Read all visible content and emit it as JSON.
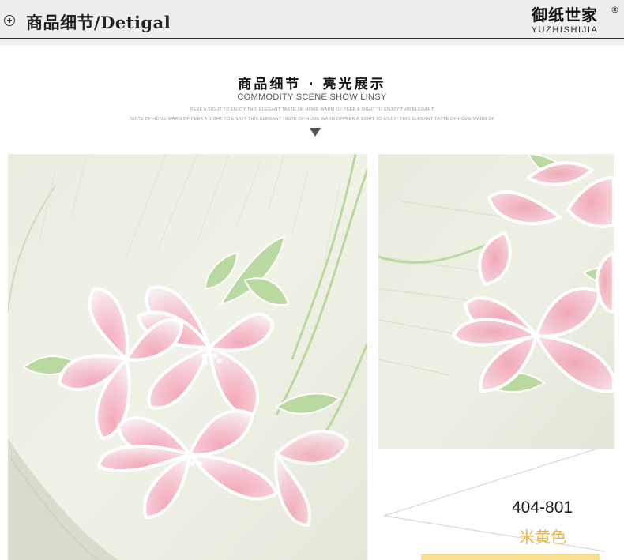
{
  "header": {
    "section_title": "商品细节/Detigal",
    "brand_name_cn": "御纸世家",
    "brand_registered": "®",
    "brand_name_en": "YUZHISHIJIA"
  },
  "intro": {
    "title": "商品细节 · 亮光展示",
    "subtitle": "COMMODITY SCENE SHOW LINSY",
    "tagline_line1": "PEEK A SIGHT TO ENJOY THIS ELEGANT TASTE OF HOME WARM OF PEEK A SIGHT TO ENJOY THIS ELEGANT",
    "tagline_line2": "TASTE OF HOME WARM OF PEEK A SIGHT TO ENJOY THIS ELEGANT TASTE OF HOME WARM OFPEEK A SIGHT TO ENJOY THIS ELEGANT TASTE OF HOME WARM OF"
  },
  "product": {
    "code": "404-801",
    "color_name": "米黄色"
  },
  "colors": {
    "header_bg": "#eeeeee",
    "wallpaper_base": "#eef0e4",
    "flower_pink": "#f2b8c2",
    "leaf_green": "#b9d9a0",
    "accent_gold": "#e7b451",
    "swatch_yellow": "#f8e08e"
  },
  "icons": {
    "header_marker": "circle-plus-icon",
    "scroll_hint": "triangle-down-icon"
  }
}
